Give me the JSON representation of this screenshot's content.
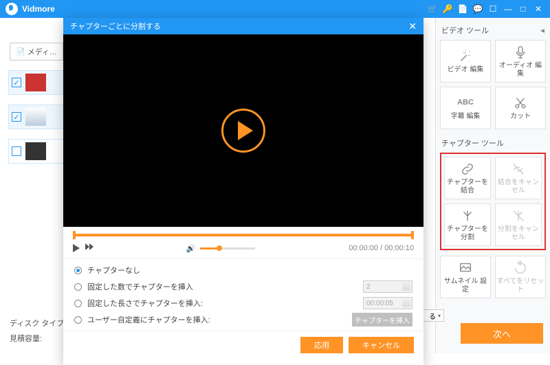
{
  "app": {
    "name": "Vidmore"
  },
  "titlebar_icons": [
    "cart",
    "key",
    "doc",
    "chat",
    "feedback",
    "min",
    "max",
    "close"
  ],
  "left": {
    "media_btn": "メディ…",
    "disk_type": "ディスク タイプ",
    "capacity": "見積容量:",
    "next": "次へ"
  },
  "dialog": {
    "title": "チャプターごとに分割する",
    "time_current": "00:00:00",
    "time_total": "00:00:10",
    "options": {
      "none": "チャプターなし",
      "fixed_count": "固定した数でチャプターを挿入",
      "fixed_length": "固定した長さでチャプターを挿入:",
      "custom": "ユーザー自定義にチャプターを挿入:",
      "count_value": "2",
      "length_value": "00:00:05",
      "insert_btn": "チャプターを挿入"
    },
    "apply": "応用",
    "cancel": "キャンセル"
  },
  "right": {
    "video_tools": "ビデオ ツール",
    "chapter_tools": "チャプター ツール",
    "tools": {
      "video_edit": "ビデオ 編集",
      "audio_edit": "オーディオ 編集",
      "subtitle_edit": "字幕 編集",
      "cut": "カット",
      "merge": "チャプターを結合",
      "merge_cancel": "結合をキャンセル",
      "split": "チャプターを分割",
      "split_cancel": "分割をキャンセル",
      "thumbnail": "サムネイル 設定",
      "reset": "すべてをリセット"
    },
    "abc": "ABC"
  }
}
